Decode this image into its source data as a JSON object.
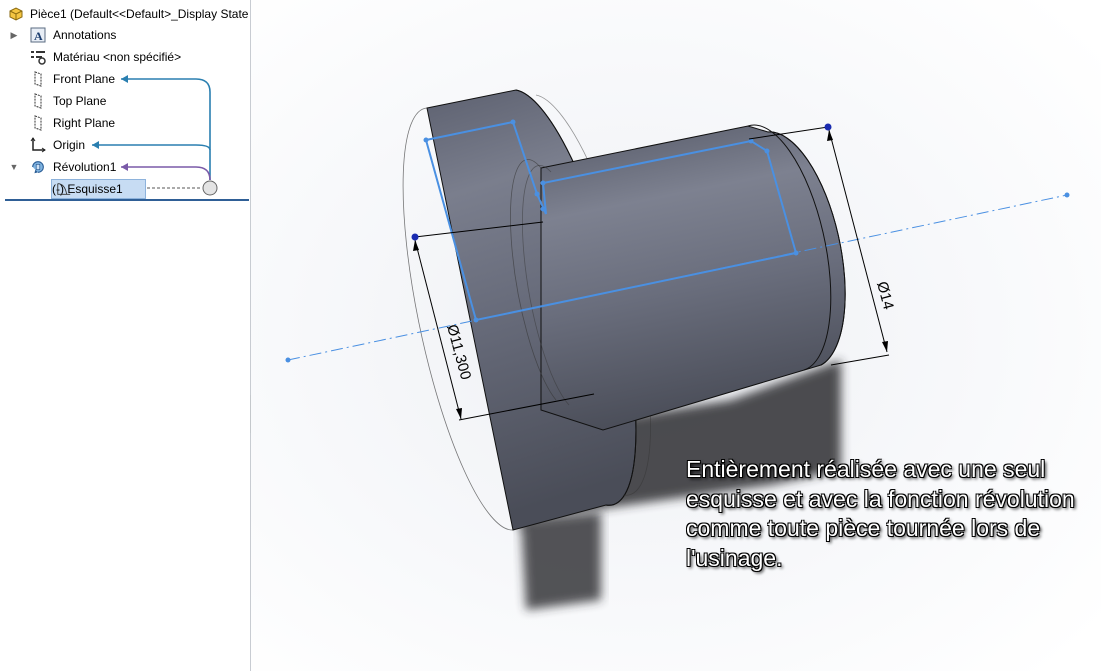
{
  "feature_tree": {
    "part": "Pièce1  (Default<<Default>_Display State",
    "items": [
      {
        "label": "Annotations",
        "icon": "annotations-icon"
      },
      {
        "label": "Matériau <non spécifié>",
        "icon": "material-icon"
      },
      {
        "label": "Front Plane",
        "icon": "plane-icon"
      },
      {
        "label": "Top Plane",
        "icon": "plane-icon"
      },
      {
        "label": "Right Plane",
        "icon": "plane-icon"
      },
      {
        "label": "Origin",
        "icon": "origin-icon"
      },
      {
        "label": "Révolution1",
        "icon": "revolve-icon"
      },
      {
        "label": "(-) Esquisse1",
        "icon": "sketch-icon"
      }
    ]
  },
  "viewport": {
    "dimensions": {
      "diameter_small": "Ø11,300",
      "diameter_large": "Ø14"
    },
    "callout": "Entièrement réalisée avec une seul esquisse et avec la fonction révolution comme toute pièce tournée lors de l'usinage."
  },
  "colors": {
    "sketch_line": "#4a90e2",
    "dependency_front": "#2a7fb0",
    "dependency_revolve": "#7a5aa8",
    "part_body": "#6f7380"
  }
}
